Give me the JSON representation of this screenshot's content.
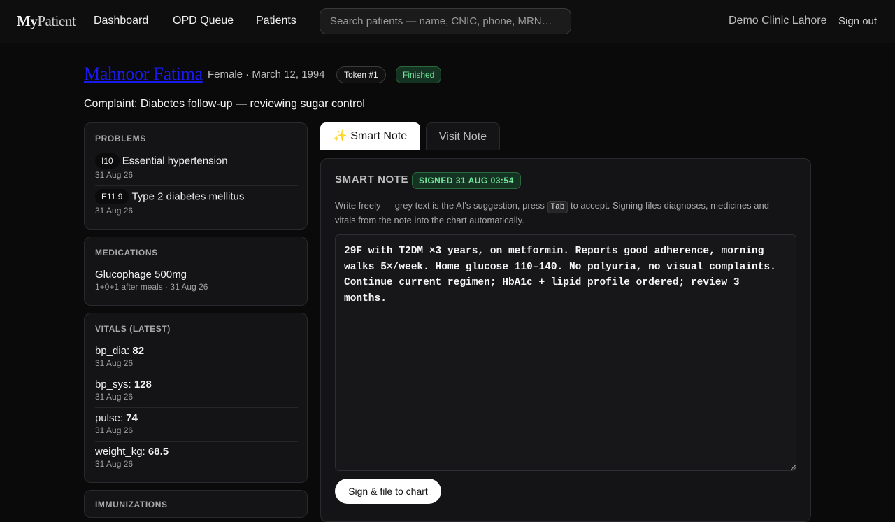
{
  "nav": {
    "logo_bold": "My",
    "logo_rest": "Patient",
    "links": [
      "Dashboard",
      "OPD Queue",
      "Patients"
    ],
    "search_placeholder": "Search patients — name, CNIC, phone, MRN…",
    "clinic": "Demo Clinic Lahore",
    "signout": "Sign out"
  },
  "patient": {
    "name": "Mahnoor Fatima",
    "meta": "Female · March 12, 1994",
    "token": "Token #1",
    "status": "Finished",
    "complaint": "Complaint: Diabetes follow-up — reviewing sugar control"
  },
  "problems": {
    "heading": "PROBLEMS",
    "items": [
      {
        "code": "I10",
        "label": "Essential hypertension",
        "date": "31 Aug 26"
      },
      {
        "code": "E11.9",
        "label": "Type 2 diabetes mellitus",
        "date": "31 Aug 26"
      }
    ]
  },
  "medications": {
    "heading": "MEDICATIONS",
    "items": [
      {
        "name": "Glucophage 500mg",
        "detail": "1+0+1 after meals · 31 Aug 26"
      }
    ]
  },
  "vitals": {
    "heading": "VITALS (LATEST)",
    "items": [
      {
        "label": "bp_dia:",
        "value": "82",
        "date": "31 Aug 26"
      },
      {
        "label": "bp_sys:",
        "value": "128",
        "date": "31 Aug 26"
      },
      {
        "label": "pulse:",
        "value": "74",
        "date": "31 Aug 26"
      },
      {
        "label": "weight_kg:",
        "value": "68.5",
        "date": "31 Aug 26"
      }
    ]
  },
  "immunizations": {
    "heading": "IMMUNIZATIONS"
  },
  "tabs": {
    "smart": "✨ Smart Note",
    "visit": "Visit Note"
  },
  "smart_note": {
    "title": "SMART NOTE",
    "signed_badge": "SIGNED 31 AUG 03:54",
    "help_before": "Write freely — grey text is the AI's suggestion, press ",
    "help_key": "Tab",
    "help_after": " to accept. Signing files diagnoses, medicines and vitals from the note into the chart automatically.",
    "note_text": "29F with T2DM ×3 years, on metformin. Reports good adherence, morning walks 5×/week. Home glucose 110–140. No polyuria, no visual complaints. Continue current regimen; HbA1c + lipid profile ordered; review 3 months.",
    "sign_button": "Sign & file to chart"
  }
}
